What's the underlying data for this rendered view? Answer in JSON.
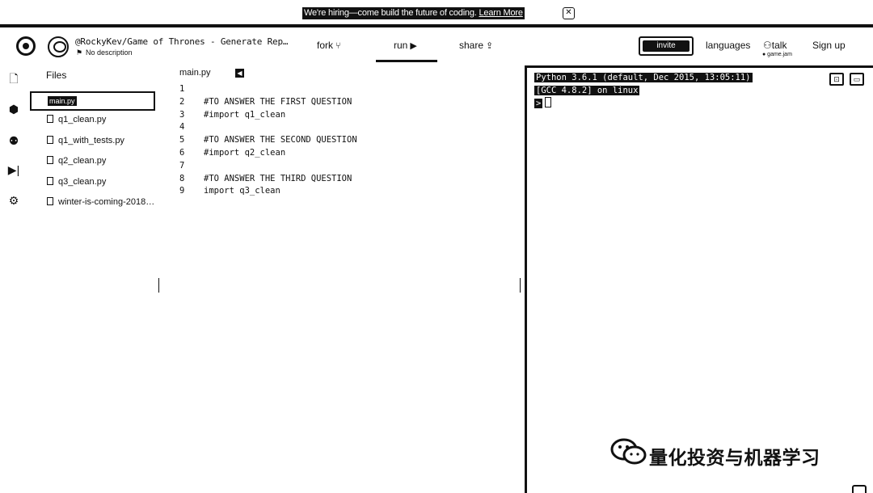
{
  "banner": {
    "text": "We're hiring—come build the future of coding.",
    "link": "Learn More",
    "close_icon": "close-icon"
  },
  "header": {
    "repo_title": "@RockyKev/Game of Thrones - Generate Rep…",
    "repo_description": "No description",
    "nav": {
      "fork": "fork",
      "run": "run",
      "share": "share"
    },
    "invite_label": "invite",
    "languages": "languages",
    "talk": "talk",
    "talk_sub": "● game.jam",
    "sign_up": "Sign up"
  },
  "sidebar": {
    "icons": [
      "file-icon",
      "package-icon",
      "users-icon",
      "debug-icon",
      "settings-icon"
    ]
  },
  "files": {
    "title": "Files",
    "selected_label": "main.py",
    "items": [
      "q1_clean.py",
      "q1_with_tests.py",
      "q2_clean.py",
      "q3_clean.py",
      "winter-is-coming-2018…"
    ]
  },
  "editor": {
    "tab": "main.py",
    "lines": [
      {
        "n": "1",
        "code": ""
      },
      {
        "n": "2",
        "code": "#TO ANSWER THE FIRST QUESTION"
      },
      {
        "n": "3",
        "code": "#import q1_clean"
      },
      {
        "n": "4",
        "code": ""
      },
      {
        "n": "5",
        "code": "#TO ANSWER THE SECOND QUESTION"
      },
      {
        "n": "6",
        "code": "#import q2_clean"
      },
      {
        "n": "7",
        "code": ""
      },
      {
        "n": "8",
        "code": "#TO ANSWER THE THIRD QUESTION"
      },
      {
        "n": "9",
        "code": "import q3_clean"
      }
    ]
  },
  "console": {
    "line1": "Python 3.6.1 (default, Dec 2015, 13:05:11)",
    "line2": "[GCC 4.8.2] on linux",
    "prompt": ">"
  },
  "watermark": {
    "text": "量化投资与机器学习"
  }
}
